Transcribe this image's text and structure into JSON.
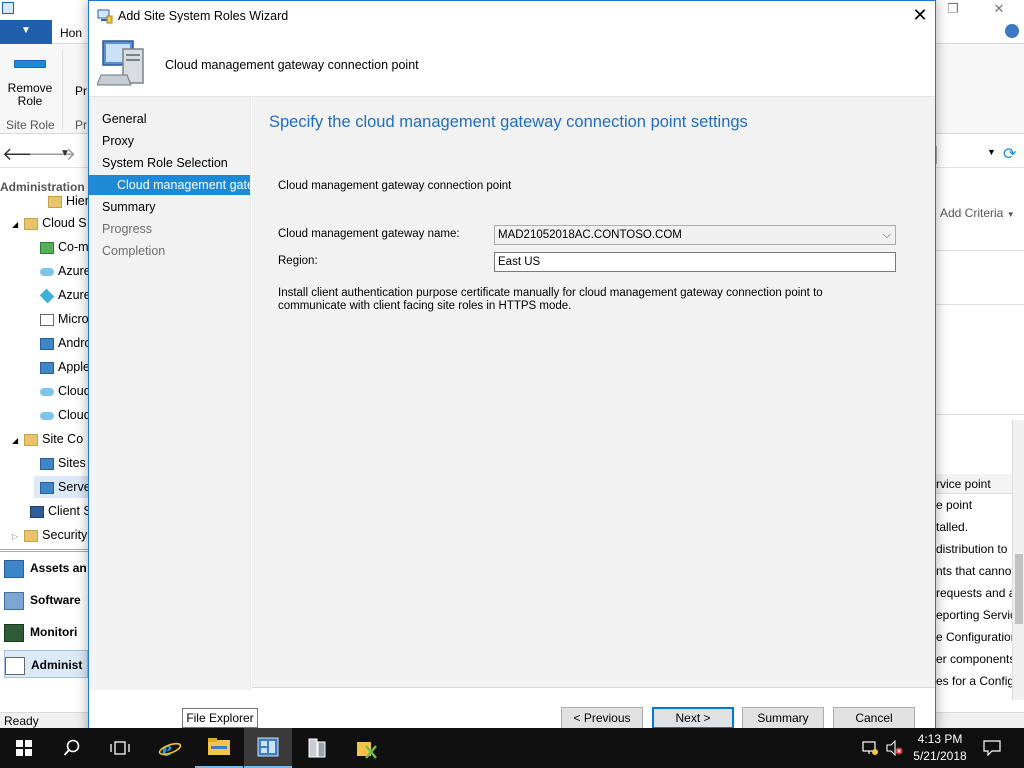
{
  "console": {
    "file_tab": "▼",
    "home_tab": "Hon",
    "remove_role": "Remove\nRole",
    "remove_role_l1": "Remove",
    "remove_role_l2": "Role",
    "ribbon_fragment": "Pr",
    "group_site_role": "Site Role",
    "group_frag": "Pr",
    "workspace_title": "Administration",
    "tree": [
      {
        "label": "Hierarc",
        "icon": "folder"
      },
      {
        "label": "Cloud S",
        "icon": "folder"
      },
      {
        "label": "Co-m",
        "icon": "puzzle-icon"
      },
      {
        "label": "Azure",
        "icon": "cloud-icon"
      },
      {
        "label": "Azure",
        "icon": "diamond-icon"
      },
      {
        "label": "Micro",
        "icon": "document-icon"
      },
      {
        "label": "Andro",
        "icon": "server-icon"
      },
      {
        "label": "Apple",
        "icon": "server-icon"
      },
      {
        "label": "Cloud",
        "icon": "cloud-icon"
      },
      {
        "label": "Cloud",
        "icon": "cloud-icon"
      },
      {
        "label": "Site Co",
        "icon": "folder"
      },
      {
        "label": "Sites",
        "icon": "server-icon"
      },
      {
        "label": "Serve",
        "icon": "server-icon"
      },
      {
        "label": "Client S",
        "icon": "monitor-icon"
      },
      {
        "label": "Security",
        "icon": "folder"
      }
    ],
    "workspaces": [
      "Assets an",
      "Software",
      "Monitori",
      "Administ"
    ],
    "status": "Ready",
    "right_panel": {
      "add_criteria": "Add Criteria",
      "header": "rvice point",
      "lines": [
        "e point",
        "talled.",
        "distribution to",
        "nts that cannot",
        "requests and a",
        "eporting Servic",
        "e Configuration",
        "er components",
        "es for a Config"
      ]
    }
  },
  "wizard": {
    "title": "Add Site System Roles Wizard",
    "header_text": "Cloud management gateway connection point",
    "nav": [
      {
        "label": "General",
        "state": "normal"
      },
      {
        "label": "Proxy",
        "state": "normal"
      },
      {
        "label": "System Role Selection",
        "state": "normal"
      },
      {
        "label": "Cloud management gateway connection point",
        "state": "selected"
      },
      {
        "label": "Summary",
        "state": "normal"
      },
      {
        "label": "Progress",
        "state": "disabled"
      },
      {
        "label": "Completion",
        "state": "disabled"
      }
    ],
    "heading": "Specify the cloud management gateway connection point settings",
    "section_label": "Cloud management gateway connection point",
    "gateway_name_label": "Cloud management gateway name:",
    "gateway_name_value": "MAD21052018AC.CONTOSO.COM",
    "region_label": "Region:",
    "region_value": "East US",
    "info": "Install client authentication purpose certificate manually for cloud management gateway connection point to communicate with client facing site roles in HTTPS mode.",
    "buttons": {
      "previous": "< Previous",
      "next": "Next >",
      "summary": "Summary",
      "cancel": "Cancel"
    }
  },
  "tooltip": "File Explorer",
  "taskbar": {
    "time": "4:13 PM",
    "date": "5/21/2018"
  },
  "colors": {
    "accent": "#1e8ad6",
    "heading": "#1e6ebf",
    "taskbar": "#101010"
  }
}
